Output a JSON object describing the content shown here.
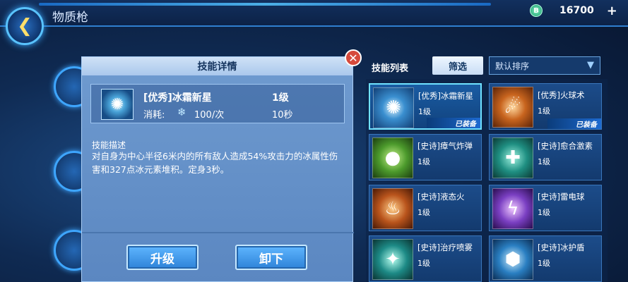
{
  "header": {
    "title": "物质枪",
    "back_icon_glyph": "❮",
    "currency_icon_letter": "B",
    "currency_value": "16700",
    "add_label": "+"
  },
  "detail": {
    "title": "技能详情",
    "close_label": "✕",
    "skill_name": "[优秀]冰霜新星",
    "skill_level": "1级",
    "cost_label": "消耗:",
    "cost_value": "100/次",
    "cooldown": "10秒",
    "desc_title": "技能描述",
    "desc_text": "对自身为中心半径6米内的所有敌人造成54%攻击力的冰属性伤害和327点冰元素堆积。定身3秒。",
    "upgrade_label": "升级",
    "unequip_label": "卸下"
  },
  "list": {
    "title": "技能列表",
    "filter_label": "筛选",
    "sort_value": "默认排序",
    "items": [
      {
        "name": "[优秀]冰霜新星",
        "level": "1级",
        "badge": "已装备",
        "icon": "frost-nova-icon",
        "color": "#3a8fd0"
      },
      {
        "name": "[优秀]火球术",
        "level": "1级",
        "badge": "已装备",
        "icon": "fireball-icon",
        "color": "#c8641e"
      },
      {
        "name": "[史诗]瘴气炸弹",
        "level": "1级",
        "badge": "",
        "icon": "miasma-bomb-icon",
        "color": "#4c9a2c"
      },
      {
        "name": "[史诗]愈合激素",
        "level": "1级",
        "badge": "",
        "icon": "healing-hormone-icon",
        "color": "#1f8f82"
      },
      {
        "name": "[史诗]液态火",
        "level": "1级",
        "badge": "",
        "icon": "liquid-fire-icon",
        "color": "#b9541c"
      },
      {
        "name": "[史诗]雷电球",
        "level": "1级",
        "badge": "",
        "icon": "thunder-ball-icon",
        "color": "#7a3fc2"
      },
      {
        "name": "[史诗]治疗喷雾",
        "level": "1级",
        "badge": "",
        "icon": "healing-spray-icon",
        "color": "#1d8a86"
      },
      {
        "name": "[史诗]冰护盾",
        "level": "1级",
        "badge": "",
        "icon": "ice-shield-icon",
        "color": "#2a7fc2"
      }
    ]
  }
}
